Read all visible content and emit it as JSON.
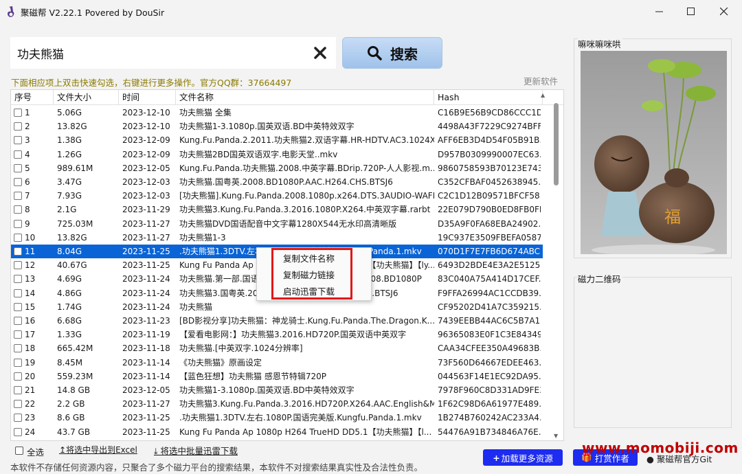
{
  "window": {
    "title": "聚磁帮 V2.22.1 Povered by DouSir",
    "buttons": [
      "minimize-icon",
      "maximize-icon",
      "close-icon"
    ]
  },
  "search": {
    "value": "功夫熊猫",
    "button_label": "搜索",
    "clear_icon": "close-icon",
    "search_icon": "search-icon"
  },
  "hint": "下面相应项上双击快速勾选，右键进行更多操作。官方QQ群：37664497",
  "update_link": "更新软件",
  "table": {
    "headers": [
      "序号",
      "文件大小",
      "时间",
      "文件名称",
      "Hash"
    ],
    "selected_index": 10,
    "rows": [
      {
        "id": "1",
        "size": "5.06G",
        "time": "2023-12-10",
        "name": "功夫熊猫 全集",
        "hash": "C16B9E56B9CD86CCC1D..."
      },
      {
        "id": "2",
        "size": "13.82G",
        "time": "2023-12-10",
        "name": "功夫熊猫1-3.1080p.国英双语.BD中英特效双字",
        "hash": "4498A43F7229C9274BFF..."
      },
      {
        "id": "3",
        "size": "1.38G",
        "time": "2023-12-09",
        "name": "Kung.Fu.Panda.2.2011.功夫熊猫2.双语字幕.HR-HDTV.AC3.1024X...",
        "hash": "AFF6EB3D4D54F05B91B..."
      },
      {
        "id": "4",
        "size": "1.26G",
        "time": "2023-12-09",
        "name": "功夫熊猫2BD国英双语双字.电影天堂..mkv",
        "hash": "D957B0309990007EC63..."
      },
      {
        "id": "5",
        "size": "989.61M",
        "time": "2023-12-05",
        "name": "Kung.Fu.Panda.功夫熊猫.2008.中英字幕.BDrip.720P-人人影视.m...",
        "hash": "9860758593B70123E743..."
      },
      {
        "id": "6",
        "size": "3.47G",
        "time": "2023-12-03",
        "name": "功夫熊猫.国粤英.2008.BD1080P.AAC.H264.CHS.BTSJ6",
        "hash": "C352CFBAF0452638945..."
      },
      {
        "id": "7",
        "size": "7.93G",
        "time": "2023-12-03",
        "name": "[功夫熊猫].Kung.Fu.Panda.2008.1080p.x264.DTS.3AUDIO-WAFHD",
        "hash": "C2C1D12B09571BFCF58..."
      },
      {
        "id": "8",
        "size": "2.1G",
        "time": "2023-11-29",
        "name": "功夫熊猫3.Kung.Fu.Panda.3.2016.1080P.X264.中英双字幕.rarbt",
        "hash": "22E079D790B0ED8FB0FF..."
      },
      {
        "id": "9",
        "size": "725.03M",
        "time": "2023-11-27",
        "name": "功夫熊猫DVD国语配音中文字幕1280X544无水印高清晰版",
        "hash": "D35A9F0FA68EBA24902..."
      },
      {
        "id": "10",
        "size": "13.82G",
        "time": "2023-11-27",
        "name": "功夫熊猫1-3",
        "hash": "19C937E3509FBEFA0587..."
      },
      {
        "id": "11",
        "size": "8.04G",
        "time": "2023-11-25",
        "name": ".功夫熊猫1.3DTV.左右.1080P.国语完美版.Kungfu.Panda.1.mkv",
        "hash": "070D1F7E7FB6D674ABC..."
      },
      {
        "id": "12",
        "size": "40.67G",
        "time": "2023-11-25",
        "name": "Kung Fu Panda Ap 1080p H264 TrueHD DD5.1【功夫熊猫】【ly...",
        "hash": "6493D2BDE4E3A2E5125..."
      },
      {
        "id": "13",
        "size": "4.69G",
        "time": "2023-11-24",
        "name": "功夫熊猫.第一部.国语.中英字幕.Kung.Fu.Panda.2008.BD1080P",
        "hash": "83C040A75A414D17CEF..."
      },
      {
        "id": "14",
        "size": "4.86G",
        "time": "2023-11-24",
        "name": "功夫熊猫3.国粤英.2016.BD1080P.AAC.H264.CHS.BTSJ6",
        "hash": "F9FFA26994AC1CCDB39..."
      },
      {
        "id": "15",
        "size": "1.74G",
        "time": "2023-11-24",
        "name": "功夫熊猫",
        "hash": "CF95202D41A7C359215..."
      },
      {
        "id": "16",
        "size": "6.68G",
        "time": "2023-11-23",
        "name": "[BD影视分享]功夫熊猫：神龙骑士.Kung.Fu.Panda.The.Dragon.K...",
        "hash": "7439EEBB44AC6C5B7A1..."
      },
      {
        "id": "17",
        "size": "1.33G",
        "time": "2023-11-19",
        "name": "【爱看电影网：】功夫熊猫3.2016.HD720P.国英双语中英双字",
        "hash": "96365083E0F1C3E84349..."
      },
      {
        "id": "18",
        "size": "665.42M",
        "time": "2023-11-18",
        "name": "功夫熊猫.[中英双字.1024分辨率]",
        "hash": "CAA34CFEE350A49683B..."
      },
      {
        "id": "19",
        "size": "8.45M",
        "time": "2023-11-14",
        "name": "《功夫熊猫》原画设定",
        "hash": "73F560D64667EDEE463..."
      },
      {
        "id": "20",
        "size": "559.23M",
        "time": "2023-11-14",
        "name": "【蓝色狂想】功夫熊猫 感恩节特辑720P",
        "hash": "044563F14E1EC92DA95..."
      },
      {
        "id": "21",
        "size": "14.8 GB",
        "time": "2023-12-05",
        "name": " 功夫熊猫1-3.1080p.国英双语.BD中英特效双字",
        "hash": "7978F960C8D331AD9FE3..."
      },
      {
        "id": "22",
        "size": "2.2 GB",
        "time": "2023-11-27",
        "name": " 功夫熊猫3.Kung.Fu.Panda.3.2016.HD720P.X264.AAC.English&M...",
        "hash": "1F62C98D6A61977E489..."
      },
      {
        "id": "23",
        "size": "8.6 GB",
        "time": "2023-11-25",
        "name": " .功夫熊猫1.3DTV.左右.1080P.国语完美版.Kungfu.Panda.1.mkv",
        "hash": "1B274B760242AC233A4..."
      },
      {
        "id": "24",
        "size": "43.7 GB",
        "time": "2023-11-25",
        "name": " Kung Fu Panda Ap 1080p H264 TrueHD DD5.1【功夫熊猫】【l...",
        "hash": "54476A91B734846A76E..."
      }
    ]
  },
  "context_menu": {
    "items": [
      "复制文件名称",
      "复制磁力链接",
      "启动迅雷下载"
    ]
  },
  "bottom": {
    "select_all": "全选",
    "export_link": "将选中导出到Excel",
    "batch_link": "将选中批量迅雷下载",
    "add_resource": "加载更多资源",
    "donate": "打赏作者",
    "git": "聚磁帮官方Git",
    "note": "本软件不存储任何资源内容，只聚合了多个磁力平台的搜索结果，本软件不对搜索结果真实性及合法性负责。"
  },
  "side": {
    "image_title": "嘛咪嘛咪哄",
    "qr_title": "磁力二维码"
  },
  "watermark": "www.momobiji.com",
  "colors": {
    "selection": "#0a64d6",
    "hint": "#8b7a00",
    "accent_button": "#1d2cf0",
    "highlight_box": "#e01818",
    "watermark": "#c00000"
  }
}
